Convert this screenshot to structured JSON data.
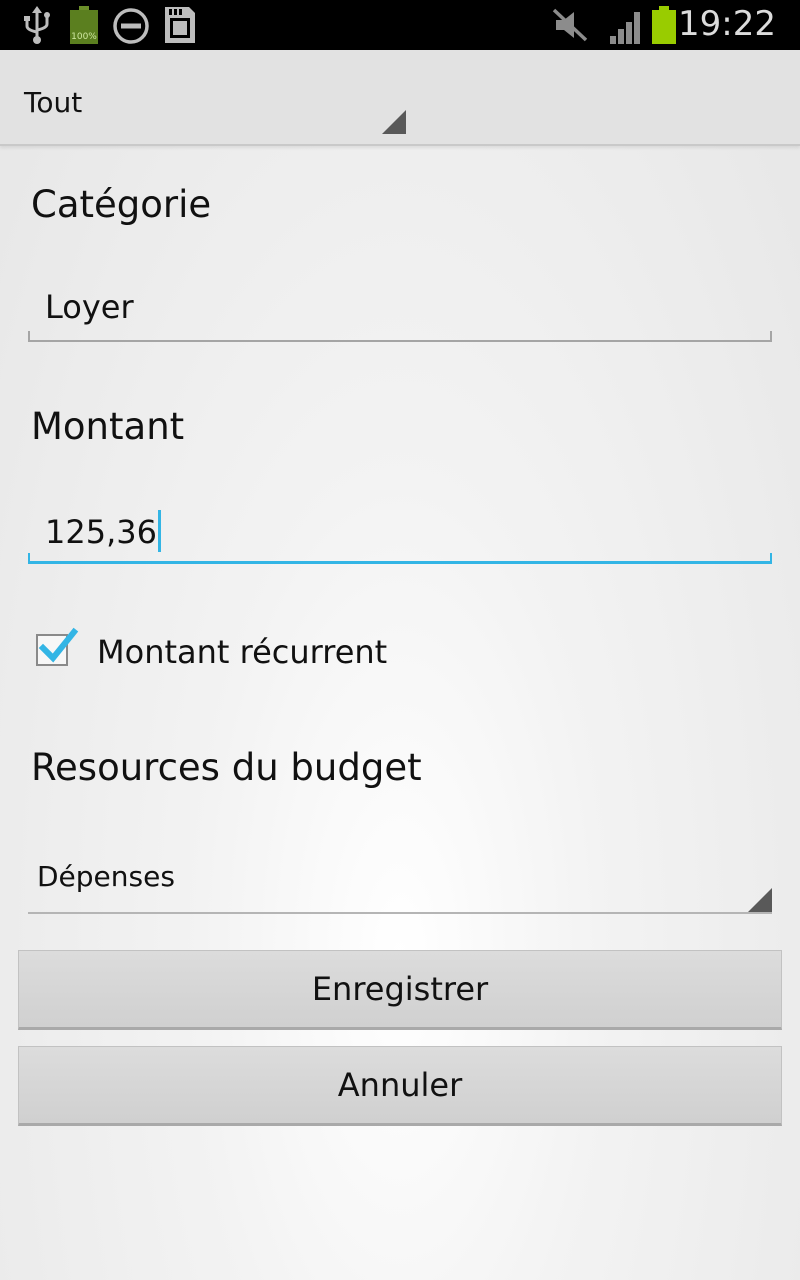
{
  "status_bar": {
    "time": "19:22",
    "battery_small_label": "100%",
    "icons": [
      "usb-icon",
      "battery-full-icon",
      "do-not-disturb-icon",
      "sd-card-icon",
      "vibrate-off-icon",
      "signal-icon",
      "battery-icon"
    ],
    "battery_color": "#99cc00"
  },
  "top_spinner": {
    "selected": "Tout"
  },
  "form": {
    "category_label": "Catégorie",
    "category_value": "Loyer",
    "amount_label": "Montant",
    "amount_value": "125,36",
    "recurring_label": "Montant récurrent",
    "recurring_checked": true,
    "budget_label": "Resources du budget",
    "budget_selected": "Dépenses"
  },
  "buttons": {
    "save": "Enregistrer",
    "cancel": "Annuler"
  },
  "colors": {
    "accent": "#33b5e5",
    "status_bar": "#000000"
  }
}
